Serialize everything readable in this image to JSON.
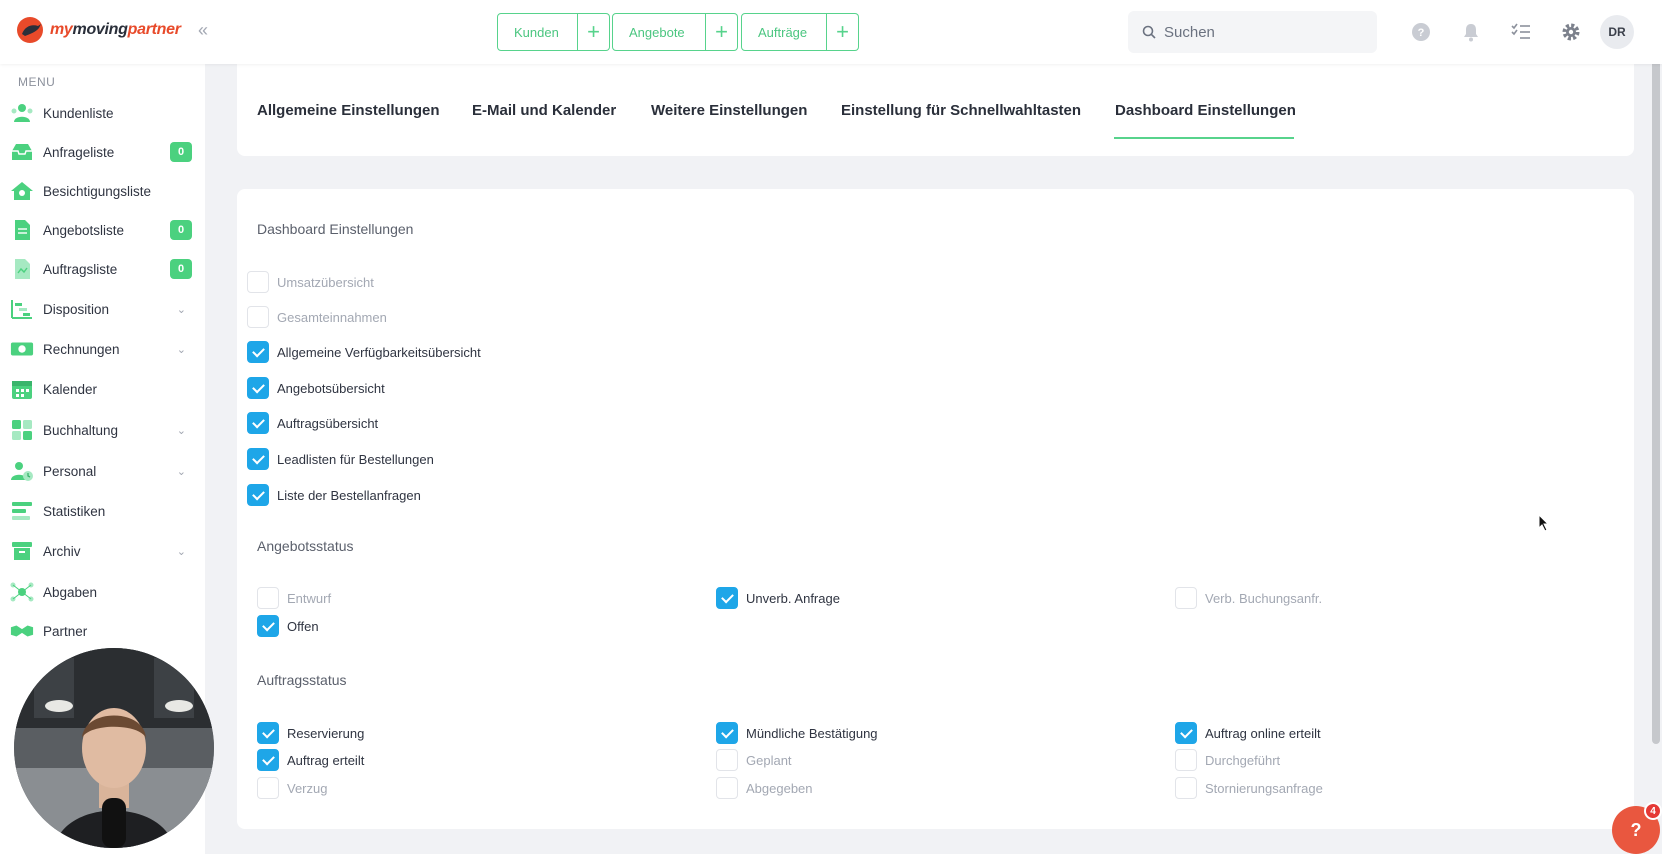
{
  "brand": {
    "part1": "my",
    "part2": "moving",
    "part3": "partner",
    "color": "#e84a2a"
  },
  "header": {
    "quick_actions": [
      {
        "label": "Kunden"
      },
      {
        "label": "Angebote"
      },
      {
        "label": "Aufträge"
      }
    ],
    "search": {
      "placeholder": "Suchen"
    },
    "icons": [
      "help-icon",
      "bell-icon",
      "checklist-icon",
      "gear-icon"
    ],
    "avatar_initials": "DR"
  },
  "sidebar": {
    "menu_label": "MENU",
    "items": [
      {
        "label": "Kundenliste",
        "icon": "users-icon"
      },
      {
        "label": "Anfrageliste",
        "icon": "inbox-icon",
        "badge": "0"
      },
      {
        "label": "Besichtigungsliste",
        "icon": "house-icon"
      },
      {
        "label": "Angebotsliste",
        "icon": "document-icon",
        "badge": "0"
      },
      {
        "label": "Auftragsliste",
        "icon": "file-icon",
        "badge": "0"
      },
      {
        "label": "Disposition",
        "icon": "gantt-icon",
        "expandable": true
      },
      {
        "label": "Rechnungen",
        "icon": "money-icon",
        "expandable": true
      },
      {
        "label": "Kalender",
        "icon": "calendar-icon"
      },
      {
        "label": "Buchhaltung",
        "icon": "calculator-icon",
        "expandable": true
      },
      {
        "label": "Personal",
        "icon": "person-clock-icon",
        "expandable": true
      },
      {
        "label": "Statistiken",
        "icon": "stats-icon"
      },
      {
        "label": "Archiv",
        "icon": "archive-icon",
        "expandable": true
      },
      {
        "label": "Abgaben",
        "icon": "network-icon"
      },
      {
        "label": "Partner",
        "icon": "handshake-icon"
      }
    ]
  },
  "tabs": [
    {
      "label": "Allgemeine Einstellungen"
    },
    {
      "label": "E-Mail und Kalender"
    },
    {
      "label": "Weitere Einstellungen"
    },
    {
      "label": "Einstellung für Schnellwahltasten"
    },
    {
      "label": "Dashboard Einstellungen",
      "active": true
    }
  ],
  "dashboard": {
    "title": "Dashboard Einstellungen",
    "options": [
      {
        "label": "Umsatzübersicht",
        "checked": false
      },
      {
        "label": "Gesamteinnahmen",
        "checked": false
      },
      {
        "label": "Allgemeine Verfügbarkeitsübersicht",
        "checked": true
      },
      {
        "label": "Angebotsübersicht",
        "checked": true
      },
      {
        "label": "Auftragsübersicht",
        "checked": true
      },
      {
        "label": "Leadlisten für Bestellungen",
        "checked": true
      },
      {
        "label": "Liste der Bestellanfragen",
        "checked": true
      }
    ]
  },
  "angebotsstatus": {
    "title": "Angebotsstatus",
    "options": [
      {
        "label": "Entwurf",
        "checked": false
      },
      {
        "label": "Unverb. Anfrage",
        "checked": true
      },
      {
        "label": "Verb. Buchungsanfr.",
        "checked": false
      },
      {
        "label": "Offen",
        "checked": true
      }
    ]
  },
  "auftragsstatus": {
    "title": "Auftragsstatus",
    "options": [
      {
        "label": "Reservierung",
        "checked": true
      },
      {
        "label": "Mündliche Bestätigung",
        "checked": true
      },
      {
        "label": "Auftrag online erteilt",
        "checked": true
      },
      {
        "label": "Auftrag erteilt",
        "checked": true
      },
      {
        "label": "Geplant",
        "checked": false
      },
      {
        "label": "Durchgeführt",
        "checked": false
      },
      {
        "label": "Verzug",
        "checked": false
      },
      {
        "label": "Abgegeben",
        "checked": false
      },
      {
        "label": "Stornierungsanfrage",
        "checked": false
      }
    ]
  },
  "help": {
    "label": "?",
    "badge": "4"
  },
  "colors": {
    "accent_green": "#57d38c",
    "checkbox_blue": "#1ea6e8",
    "badge_green": "#4bd17f"
  }
}
